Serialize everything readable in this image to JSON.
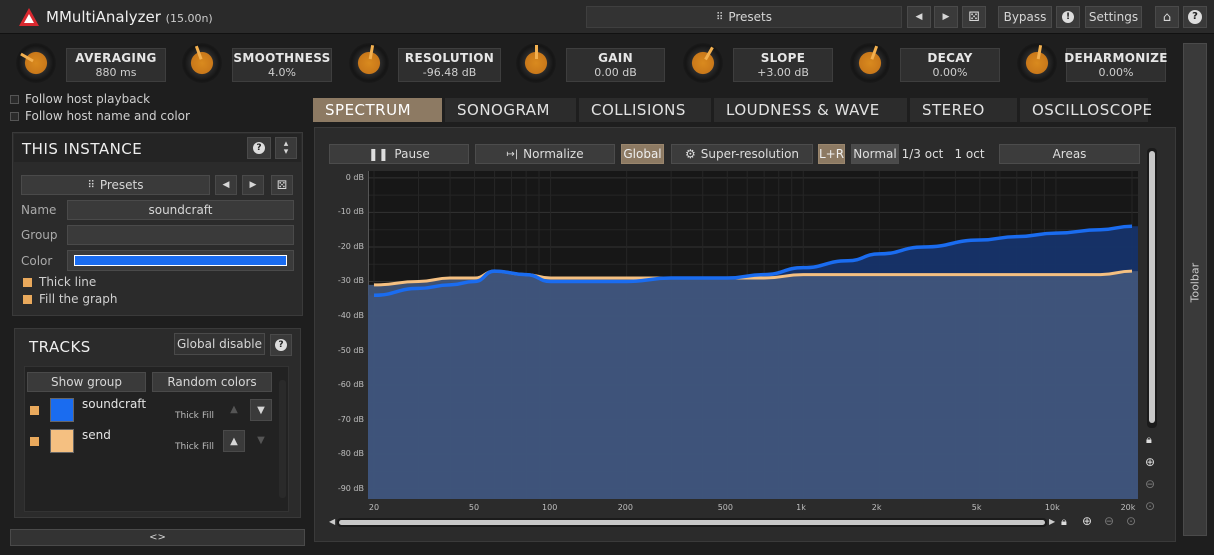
{
  "header": {
    "app_name": "MMultiAnalyzer",
    "version": "(15.00n)",
    "presets_label": "Presets",
    "bypass_label": "Bypass",
    "settings_label": "Settings"
  },
  "knobs": [
    {
      "name": "AVERAGING",
      "value": "880 ms"
    },
    {
      "name": "SMOOTHNESS",
      "value": "4.0%"
    },
    {
      "name": "RESOLUTION",
      "value": "-96.48 dB"
    },
    {
      "name": "GAIN",
      "value": "0.00 dB"
    },
    {
      "name": "SLOPE",
      "value": "+3.00 dB"
    },
    {
      "name": "DECAY",
      "value": "0.00%"
    },
    {
      "name": "DEHARMONIZE",
      "value": "0.00%"
    }
  ],
  "options": {
    "follow_playback": "Follow host playback",
    "follow_name": "Follow host name and color"
  },
  "tabs": [
    "SPECTRUM",
    "SONOGRAM",
    "COLLISIONS",
    "LOUDNESS & WAVE",
    "STEREO",
    "OSCILLOSCOPE"
  ],
  "instance": {
    "title": "THIS INSTANCE",
    "presets_label": "Presets",
    "name_label": "Name",
    "name_value": "soundcraft",
    "group_label": "Group",
    "group_value": "",
    "color_label": "Color",
    "color_value": "#1a6cf0",
    "thick_line": "Thick line",
    "fill_graph": "Fill the graph"
  },
  "tracks": {
    "title": "TRACKS",
    "global_disable": "Global disable",
    "show_group": "Show group",
    "random_colors": "Random colors",
    "items": [
      {
        "name": "soundcraft",
        "thick": "Thick",
        "fill": "Fill",
        "color": "#1a6cf0"
      },
      {
        "name": "send",
        "thick": "Thick",
        "fill": "Fill",
        "color": "#f5c081"
      }
    ]
  },
  "spectrum_toolbar": {
    "pause": "Pause",
    "normalize": "Normalize",
    "global": "Global",
    "super_resolution": "Super-resolution",
    "lr": "L+R",
    "normal": "Normal",
    "third_oct": "1/3 oct",
    "one_oct": "1 oct",
    "areas": "Areas"
  },
  "toolbar_label": "Toolbar",
  "bottom_toggle": "<>",
  "chart_data": {
    "type": "area",
    "ylabel": "",
    "xlabel": "",
    "y_ticks": [
      "0 dB",
      "-10 dB",
      "-20 dB",
      "-30 dB",
      "-40 dB",
      "-50 dB",
      "-60 dB",
      "-70 dB",
      "-80 dB",
      "-90 dB"
    ],
    "x_ticks": [
      "20",
      "50",
      "100",
      "200",
      "500",
      "1k",
      "2k",
      "5k",
      "10k",
      "20k"
    ],
    "ylim": [
      -93,
      2
    ],
    "xlim": [
      20,
      20000
    ],
    "x_scale": "log",
    "series": [
      {
        "name": "soundcraft",
        "color": "#1a6cf0",
        "x": [
          20,
          30,
          40,
          50,
          60,
          80,
          100,
          150,
          200,
          300,
          500,
          700,
          1000,
          1500,
          2000,
          3000,
          5000,
          7000,
          10000,
          15000,
          20000
        ],
        "y": [
          -34,
          -32,
          -31,
          -30,
          -27,
          -28,
          -30,
          -30,
          -30,
          -29,
          -29,
          -28,
          -26,
          -24,
          -22,
          -20,
          -18,
          -17,
          -16,
          -15,
          -14
        ]
      },
      {
        "name": "send",
        "color": "#f5c081",
        "x": [
          20,
          30,
          40,
          50,
          60,
          80,
          100,
          150,
          200,
          300,
          500,
          700,
          1000,
          1500,
          2000,
          3000,
          5000,
          7000,
          10000,
          15000,
          20000
        ],
        "y": [
          -31,
          -30,
          -29,
          -29,
          -27,
          -28,
          -29,
          -29,
          -29,
          -29,
          -29,
          -29,
          -28,
          -28,
          -28,
          -28,
          -28,
          -28,
          -28,
          -28,
          -27
        ]
      }
    ]
  }
}
